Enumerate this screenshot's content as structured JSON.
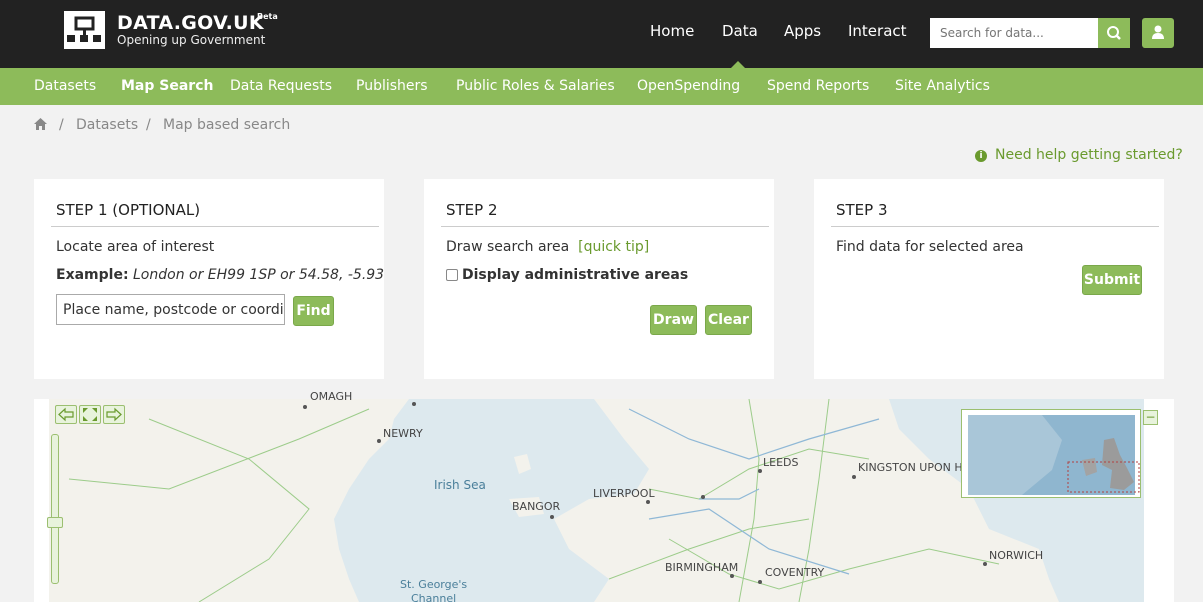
{
  "header": {
    "brand_title": "DATA.GOV.UK",
    "brand_badge": "Beta",
    "brand_subtitle": "Opening up Government",
    "nav": [
      "Home",
      "Data",
      "Apps",
      "Interact"
    ],
    "active_nav": "Data",
    "search_placeholder": "Search for data...",
    "search_icon": "search-icon",
    "user_icon": "user-icon"
  },
  "subnav": {
    "items": [
      "Datasets",
      "Map Search",
      "Data Requests",
      "Publishers",
      "Public Roles & Salaries",
      "OpenSpending",
      "Spend Reports",
      "Site Analytics"
    ],
    "active": "Map Search"
  },
  "breadcrumb": {
    "home_icon": "home-icon",
    "separator": "/",
    "items": [
      "Datasets",
      "Map based search"
    ]
  },
  "help_link": "Need help getting started?",
  "step1": {
    "title": "STEP 1 (OPTIONAL)",
    "subtitle": "Locate area of interest",
    "example_label": "Example:",
    "example_text": "London or EH99 1SP or 54.58, -5.93",
    "input_value": "Place name, postcode or coordir",
    "find_label": "Find"
  },
  "step2": {
    "title": "STEP 2",
    "subtitle": "Draw search area",
    "quick_tip": "[quick tip]",
    "checkbox_label": "Display administrative areas",
    "draw_label": "Draw",
    "clear_label": "Clear"
  },
  "step3": {
    "title": "STEP 3",
    "subtitle": "Find data for selected area",
    "submit_label": "Submit"
  },
  "map": {
    "labels": [
      "OMAGH",
      "NEWRY",
      "Irish Sea",
      "BANGOR",
      "LIVERPOOL",
      "LEEDS",
      "KINGSTON UPON HU",
      "NORWICH",
      "BIRMINGHAM",
      "COVENTRY",
      "St. George's",
      "Channel"
    ],
    "pan_left_icon": "arrow-left-icon",
    "zoom_extent_icon": "expand-icon",
    "pan_right_icon": "arrow-right-icon",
    "minimize_label": "−"
  },
  "colors": {
    "accent": "#8dbb5a",
    "topbar": "#222222",
    "link": "#6a9a2e",
    "sea": "#dde9ee",
    "land": "#f3f2ec"
  }
}
